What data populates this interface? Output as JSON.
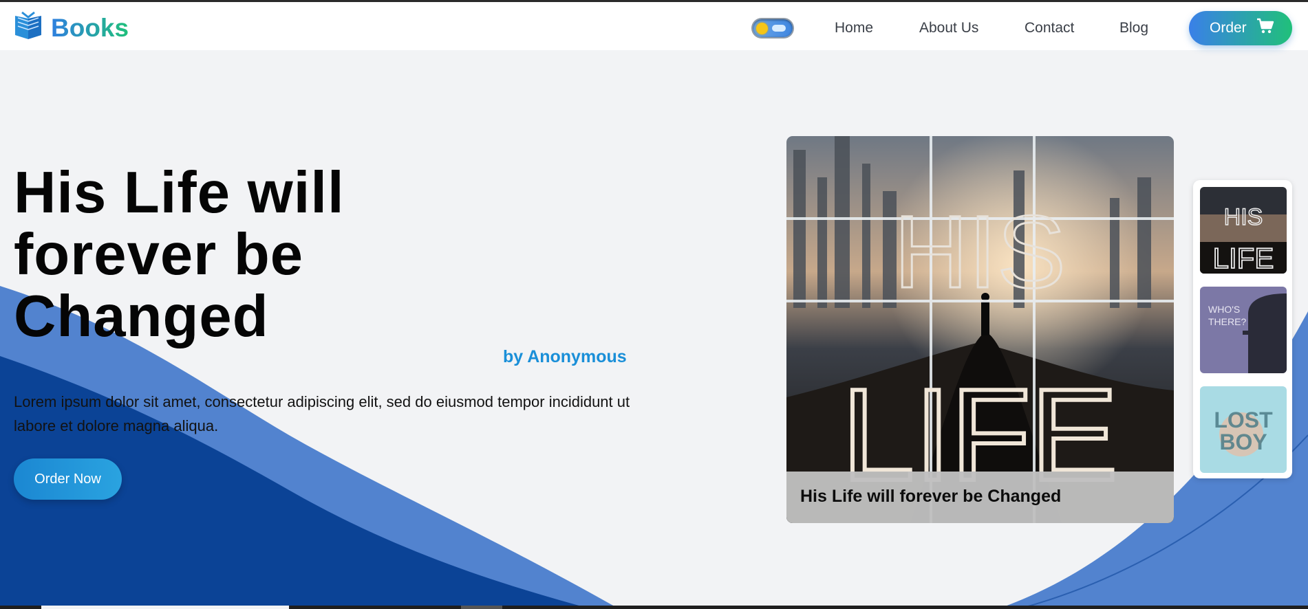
{
  "header": {
    "brand": "Books",
    "nav": [
      "Home",
      "About Us",
      "Contact",
      "Blog"
    ],
    "order_label": "Order"
  },
  "hero": {
    "title": "His Life will forever be Changed",
    "author": "by Anonymous",
    "description": "Lorem ipsum dolor sit amet, consectetur adipiscing elit, sed do eiusmod tempor incididunt ut labore et dolore magna aliqua.",
    "cta_label": "Order Now"
  },
  "featured": {
    "caption": "His Life will forever be Changed",
    "cover_text": "HIS LIFE"
  },
  "thumbnails": [
    {
      "cover_text": "HIS LIFE"
    },
    {
      "cover_text": "WHO'S THERE?"
    },
    {
      "cover_text": "LOST BOY"
    }
  ],
  "icons": {
    "logo": "open-book-icon",
    "theme_toggle": "sun-icon",
    "order": "cart-icon"
  },
  "colors": {
    "brand_gradient_start": "#2f7fe0",
    "brand_gradient_end": "#1fc07a",
    "accent": "#1a8fd8",
    "wave_dark": "#0b4396",
    "wave_light": "#4e7fcc"
  }
}
